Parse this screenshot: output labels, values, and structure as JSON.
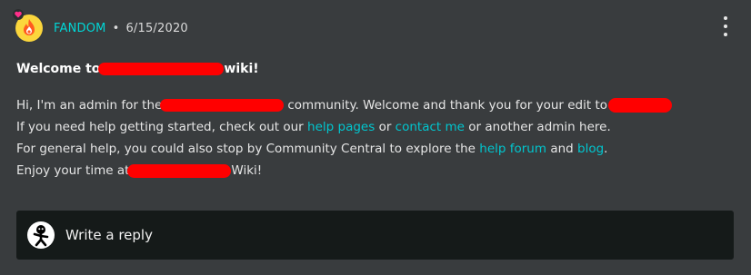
{
  "post": {
    "source": "FANDOM",
    "separator": "•",
    "date": "6/15/2020",
    "title_prefix": "Welcome to",
    "title_suffix": "wiki!",
    "lines": {
      "l1_a": "Hi, I'm an admin for the",
      "l1_b": "community. Welcome and thank you for your edit to",
      "l2_a": "If you need help getting started, check out our",
      "l2_link1": "help pages",
      "l2_b": "or",
      "l2_link2": "contact me",
      "l2_c": "or another admin here.",
      "l3_a": "For general help, you could also stop by Community Central to explore the",
      "l3_link1": "help forum",
      "l3_b": "and",
      "l3_link2": "blog",
      "l3_c": ".",
      "l4_a": "Enjoy your time at",
      "l4_b": "Wiki!"
    }
  },
  "reply": {
    "placeholder": "Write a reply"
  },
  "colors": {
    "accent": "#00d6d6",
    "redaction": "#ff0000",
    "background": "#393c3e",
    "reply_box": "#151a19"
  },
  "icons": {
    "source_avatar": "fandom-flame-icon",
    "badge": "heart-badge-icon",
    "menu": "kebab-menu-icon",
    "user": "user-avatar-icon"
  }
}
